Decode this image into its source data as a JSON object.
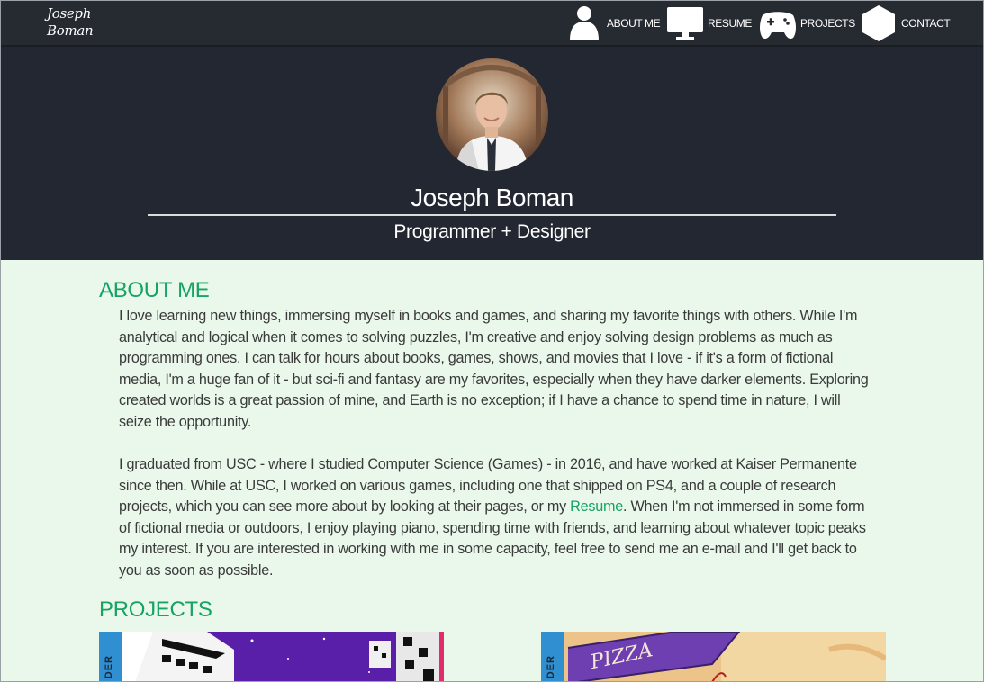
{
  "nav": {
    "logo_line1": "Joseph",
    "logo_line2": "Boman",
    "items": [
      {
        "label": "ABOUT ME",
        "icon": "person-icon"
      },
      {
        "label": "RESUME",
        "icon": "monitor-icon"
      },
      {
        "label": "PROJECTS",
        "icon": "gamepad-icon"
      },
      {
        "label": "CONTACT",
        "icon": "hexagon-icon"
      }
    ]
  },
  "hero": {
    "name": "Joseph Boman",
    "subtitle": "Programmer + Designer"
  },
  "about": {
    "title": "ABOUT ME",
    "paragraph1": "I love learning new things, immersing myself in books and games, and sharing my favorite things with others. While I'm analytical and logical when it comes to solving puzzles, I'm creative and enjoy solving design problems as much as programming ones. I can talk for hours about books, games, shows, and movies that I love - if it's a form of fictional media, I'm a huge fan of it - but sci-fi and fantasy are my favorites, especially when they have darker elements. Exploring created worlds is a great passion of mine, and Earth is no exception; if I have a chance to spend time in nature, I will seize the opportunity.",
    "paragraph2_before": "I graduated from USC - where I studied Computer Science (Games) - in 2016, and have worked at Kaiser Permanente since then. While at USC, I worked on various games, including one that shipped on PS4, and a couple of research projects, which you can see more about by looking at their pages, or my ",
    "paragraph2_link": "Resume",
    "paragraph2_after": ". When I'm not immersed in some form of fictional media or outdoors, I enjoy playing piano, spending time with friends, and learning about whatever topic peaks my interest. If you are interested in working with me in some capacity, feel free to send me an e-mail and I'll get back to you as soon as possible."
  },
  "projects": {
    "title": "PROJECTS",
    "cards": [
      {
        "tag": "DER"
      },
      {
        "tag": "DER",
        "art_text": "PIZZA"
      }
    ]
  },
  "colors": {
    "nav_bg": "#262a31",
    "hero_bg": "#232731",
    "page_bg": "#eaf8ec",
    "accent": "#16a364",
    "tag_blue": "#2f8fd0"
  }
}
